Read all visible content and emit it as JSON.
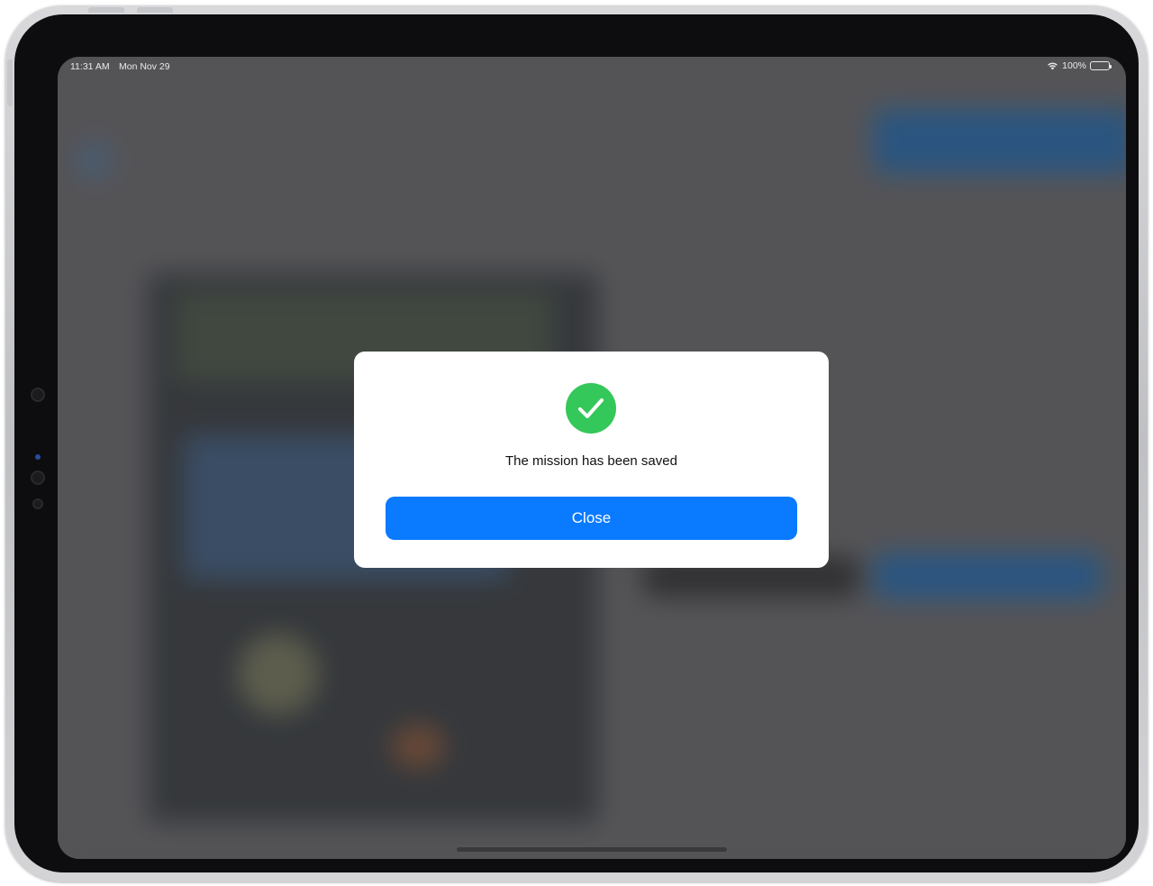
{
  "status_bar": {
    "time": "11:31 AM",
    "date": "Mon Nov 29",
    "battery": "100%",
    "wifi_icon": "wifi-icon",
    "battery_icon": "battery-icon"
  },
  "dialog": {
    "icon": "checkmark-circle-icon",
    "message": "The mission has been saved",
    "close_label": "Close"
  },
  "colors": {
    "accent": "#0a7aff",
    "success": "#34c759",
    "scrim": "#5a5a5d"
  }
}
